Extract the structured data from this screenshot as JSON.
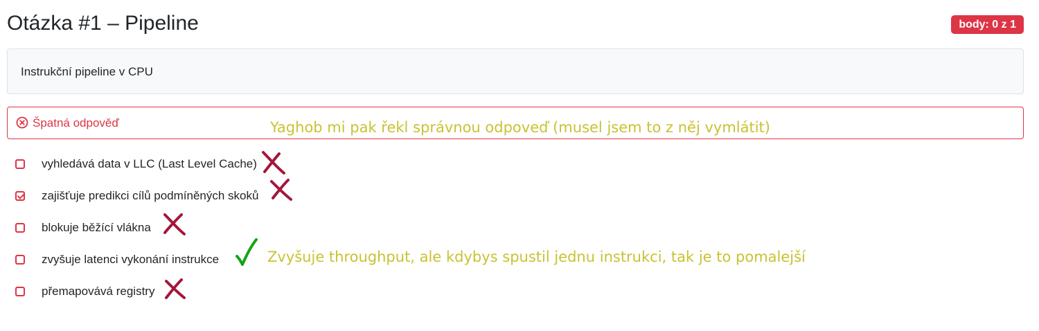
{
  "question": {
    "title": "Otázka #1 – Pipeline",
    "score_badge": "body: 0 z 1",
    "description": "Instrukční pipeline v CPU"
  },
  "feedback": {
    "status": "Špatná odpověď",
    "status_icon": "x-circle-icon"
  },
  "options": [
    {
      "label": "vyhledává data v LLC (Last Level Cache)",
      "checked": false,
      "mark": "wrong"
    },
    {
      "label": "zajišťuje predikci cílů podmíněných skoků",
      "checked": true,
      "mark": "wrong"
    },
    {
      "label": "blokuje běžící vlákna",
      "checked": false,
      "mark": "wrong"
    },
    {
      "label": "zvyšuje latenci vykonání instrukce",
      "checked": false,
      "mark": "correct"
    },
    {
      "label": "přemapovává registry",
      "checked": false,
      "mark": "wrong"
    }
  ],
  "annotations": {
    "note_top": "Yaghob mi pak řekl správnou odpoveď (musel jsem to z něj vymlátit)",
    "note_bottom": "Zvyšuje throughput, ale kdybys spustil jednu instrukci, tak je to pomalejší"
  },
  "colors": {
    "danger": "#dc3545",
    "annotation_text": "#c9c232",
    "cross_mark": "#a3173b",
    "check_mark": "#16a316"
  }
}
